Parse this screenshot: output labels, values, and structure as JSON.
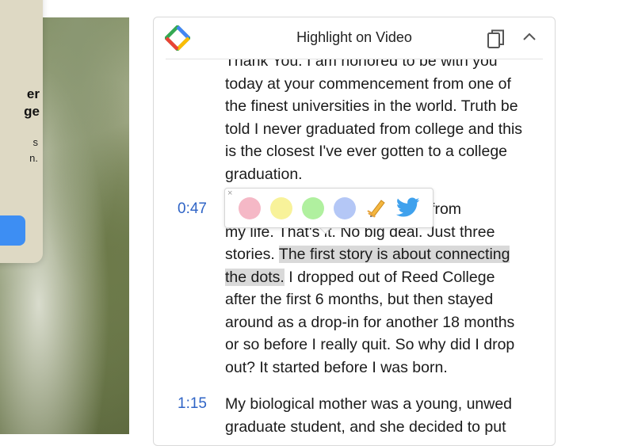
{
  "background_modal": {
    "heading_fragment": "er\nge",
    "text_fragment": "s\nn.",
    "button_color": "#3d8ef3"
  },
  "panel": {
    "title": "Highlight on Video",
    "icons": [
      "highlight-logo-icon",
      "copy-icon",
      "chevron-up-icon"
    ]
  },
  "transcript": [
    {
      "timestamp": "",
      "lines": [
        "Thank You. I am honored to be with you",
        "today at your commencement from one of",
        "the finest universities in the world. Truth be",
        "told I never graduated from college and this",
        "is the closest I've ever gotten to a college",
        "graduation."
      ]
    },
    {
      "timestamp": "0:47",
      "line1": "I want to tell you three stories from",
      "line2": "my life. That's it. No big deal. Just three",
      "line3_before": "stories. ",
      "highlight_part1": "The first story is about connecting",
      "highlight_part2": "the dots.",
      "line4_after": " I dropped out of Reed College",
      "lines_rest": [
        "after the first 6 months, but then stayed",
        "around as a drop-in for another 18 months",
        "or so before I really quit. So why did I drop",
        "out? It started before I was born."
      ]
    },
    {
      "timestamp": "1:15",
      "lines": [
        "My biological mother was a young, unwed",
        "graduate student, and she decided to put"
      ]
    }
  ],
  "toolbar": {
    "close_glyph": "×",
    "colors": [
      {
        "name": "pink",
        "hex": "#f5b8c6"
      },
      {
        "name": "yellow",
        "hex": "#f8f29a"
      },
      {
        "name": "green",
        "hex": "#b0f09f"
      },
      {
        "name": "blue",
        "hex": "#b4c7f6"
      }
    ],
    "actions": [
      "write-note-icon",
      "twitter-icon"
    ]
  },
  "accent": "#2f64c6"
}
